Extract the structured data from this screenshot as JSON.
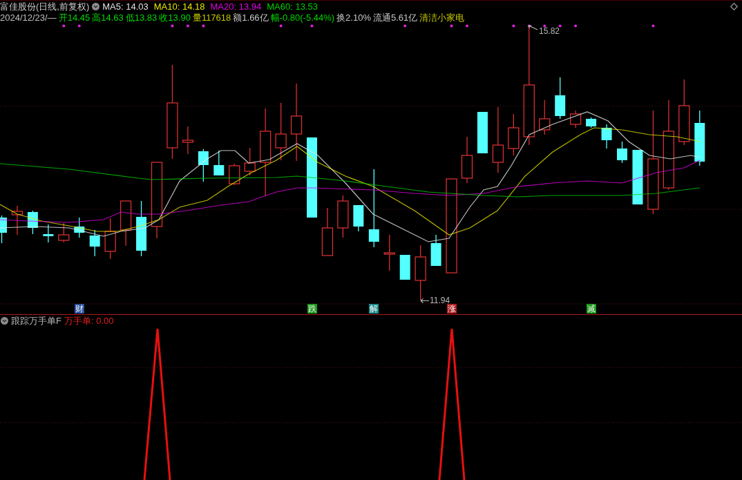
{
  "header": {
    "title": "富佳股份(日线,前复权)",
    "moving_averages": [
      {
        "label": "MA5: 14.03",
        "color": "#e0e0e0"
      },
      {
        "label": "MA10: 14.18",
        "color": "#e8e800"
      },
      {
        "label": "MA20: 13.94",
        "color": "#e000e0"
      },
      {
        "label": "MA60: 13.53",
        "color": "#00d000"
      }
    ]
  },
  "quote": {
    "date": "2024/12/23/—",
    "fields": [
      {
        "text": "开14.45",
        "color": "#00d800"
      },
      {
        "text": "高14.63",
        "color": "#00d800"
      },
      {
        "text": "低13.83",
        "color": "#00d800"
      },
      {
        "text": "收13.90",
        "color": "#00d800"
      },
      {
        "text": "量117618",
        "color": "#c8c800"
      },
      {
        "text": "额1.66亿",
        "color": "#c8c8c8"
      },
      {
        "text": "幅-0.80(-5.44%)",
        "color": "#00d800"
      },
      {
        "text": "换2.10%",
        "color": "#c8c8c8"
      },
      {
        "text": "流通5.61亿",
        "color": "#c8c8c8"
      },
      {
        "text": "清洁小家电",
        "color": "#c8c800"
      }
    ]
  },
  "chart": {
    "high_label": "15.82",
    "low_label": "11.94",
    "markers": [
      {
        "text": "财",
        "color": "#2a50a0"
      },
      {
        "text": "跌",
        "color": "#1a9a1a"
      },
      {
        "text": "解",
        "color": "#1a8c8c"
      },
      {
        "text": "涨",
        "color": "#b01c1c"
      },
      {
        "text": "减",
        "color": "#1a9a1a"
      }
    ]
  },
  "indicator": {
    "title": "跟踪万手单F",
    "value": "万手单: 0.00"
  }
}
